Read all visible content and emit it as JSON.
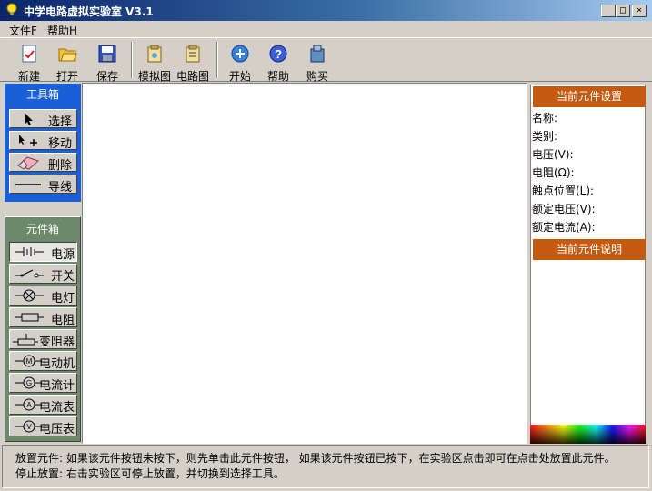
{
  "window": {
    "title": "中学电路虚拟实验室  V3.1",
    "minimize": "_",
    "maximize": "□",
    "close": "×"
  },
  "menu": [
    {
      "label": "文件F"
    },
    {
      "label": "帮助H"
    }
  ],
  "toolbar": [
    {
      "label": "新建",
      "icon": "new-file-icon"
    },
    {
      "label": "打开",
      "icon": "open-folder-icon"
    },
    {
      "label": "保存",
      "icon": "save-disk-icon"
    },
    {
      "label": "模拟图",
      "icon": "simulation-diagram-icon"
    },
    {
      "label": "电路图",
      "icon": "circuit-diagram-icon"
    },
    {
      "label": "开始",
      "icon": "start-icon"
    },
    {
      "label": "帮助",
      "icon": "help-icon"
    },
    {
      "label": "购买",
      "icon": "buy-icon"
    }
  ],
  "toolbox": {
    "title": "工具箱",
    "tools": [
      {
        "label": "选择",
        "icon": "arrow-cursor-icon"
      },
      {
        "label": "移动",
        "icon": "move-cursor-icon"
      },
      {
        "label": "删除",
        "icon": "eraser-icon"
      },
      {
        "label": "导线",
        "icon": "wire-line-icon"
      }
    ]
  },
  "components": {
    "title": "元件箱",
    "items": [
      {
        "label": "电源",
        "icon": "battery-symbol-icon"
      },
      {
        "label": "开关",
        "icon": "switch-symbol-icon"
      },
      {
        "label": "电灯",
        "icon": "lamp-symbol-icon"
      },
      {
        "label": "电阻",
        "icon": "resistor-symbol-icon"
      },
      {
        "label": "变阻器",
        "icon": "rheostat-symbol-icon"
      },
      {
        "label": "电动机",
        "icon": "motor-symbol-icon"
      },
      {
        "label": "电流计",
        "icon": "galvanometer-symbol-icon"
      },
      {
        "label": "电流表",
        "icon": "ammeter-symbol-icon"
      },
      {
        "label": "电压表",
        "icon": "voltmeter-symbol-icon"
      }
    ]
  },
  "right_panel": {
    "settings_title": "当前元件设置",
    "fields": [
      "名称:",
      "类别:",
      "电压(V):",
      "电阻(Ω):",
      "触点位置(L):",
      "额定电压(V):",
      "额定电流(A):"
    ],
    "description_title": "当前元件说明"
  },
  "status": {
    "line1": "放置元件:  如果该元件按钮未按下，则先单击此元件按钮，  如果该元件按钮已按下，在实验区点击即可在点击处放置此元件。",
    "line2": "停止放置:  右击实验区可停止放置，并切换到选择工具。"
  },
  "colors": {
    "titlebar": "#0a246a",
    "toolbox_bg": "#1a5fd6",
    "compbox_bg": "#6a8a6a",
    "panel_header": "#c55a11",
    "face": "#d4d0c8"
  }
}
